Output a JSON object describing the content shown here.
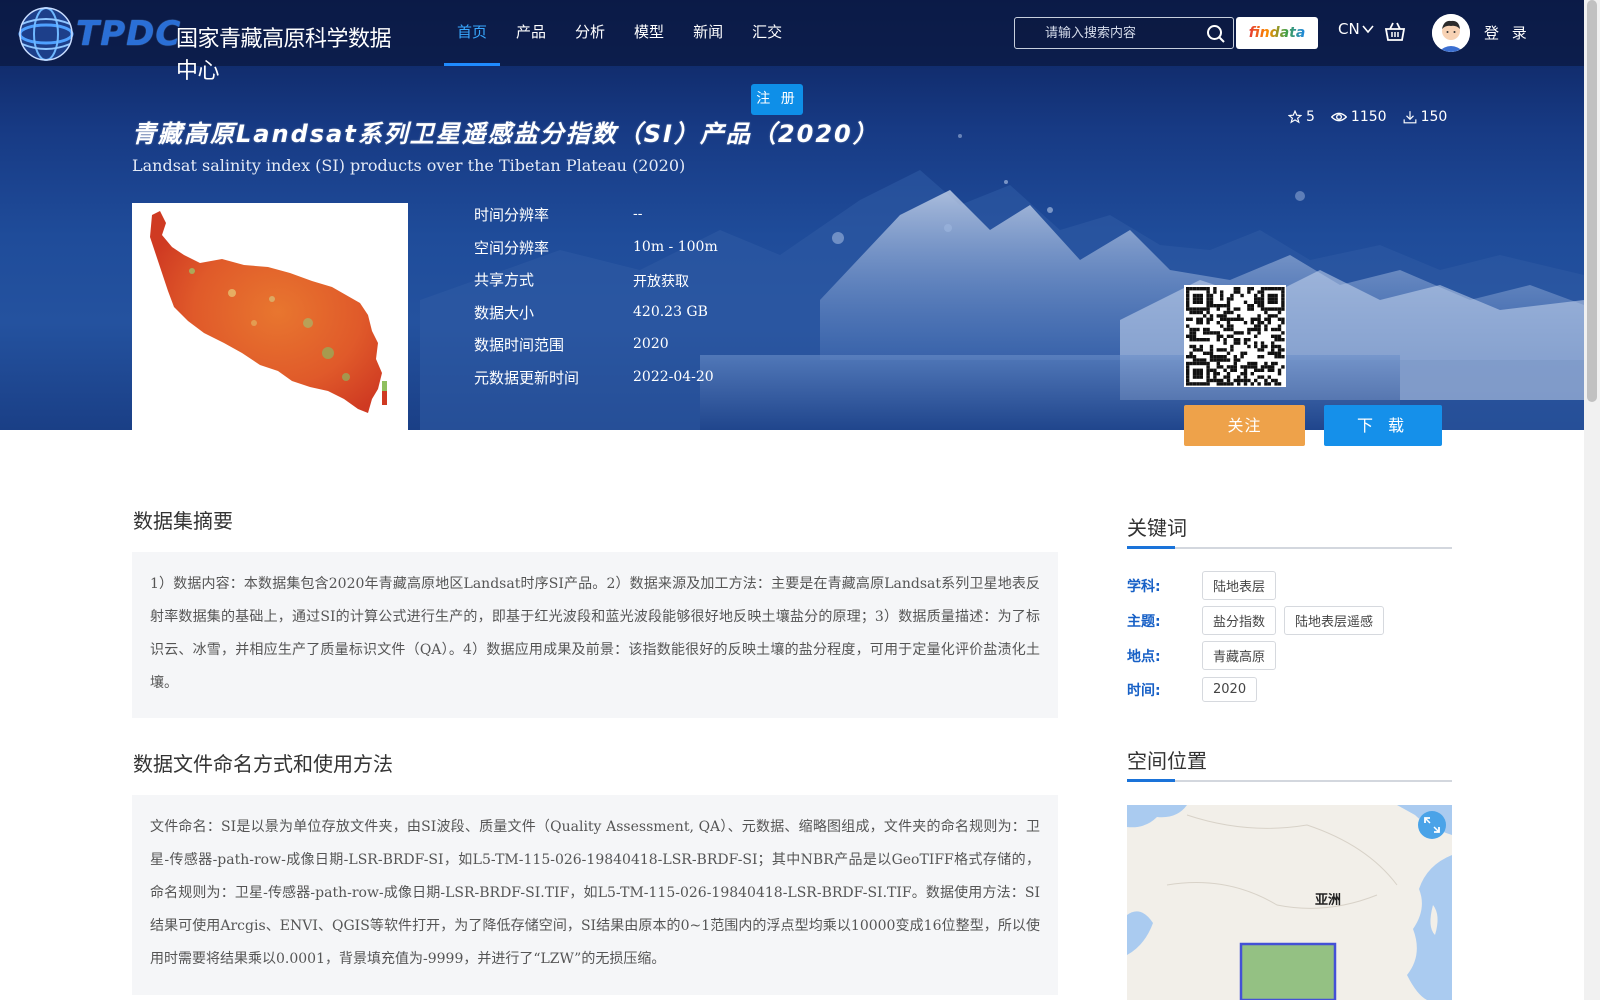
{
  "nav": {
    "logo_text": "TPDC",
    "site_name": "国家青藏高原科学数据中心",
    "items": [
      {
        "label": "首页",
        "active": true
      },
      {
        "label": "产品",
        "active": false
      },
      {
        "label": "分析",
        "active": false
      },
      {
        "label": "模型",
        "active": false
      },
      {
        "label": "新闻",
        "active": false
      },
      {
        "label": "汇交",
        "active": false
      }
    ],
    "search_placeholder": "请输入搜索内容",
    "findata_label": "findata",
    "language": "CN",
    "login_label": "登 录",
    "register_label": "注 册"
  },
  "dataset": {
    "title_cn": "青藏高原Landsat系列卫星遥感盐分指数（SI）产品（2020）",
    "title_en": "Landsat salinity index (SI) products over the Tibetan Plateau (2020)",
    "stats": {
      "stars": "5",
      "views": "1150",
      "downloads": "150"
    },
    "meta": [
      {
        "key": "时间分辨率",
        "value": "--"
      },
      {
        "key": "空间分辨率",
        "value": "10m - 100m"
      },
      {
        "key": "共享方式",
        "value": "开放获取"
      },
      {
        "key": "数据大小",
        "value": "420.23 GB"
      },
      {
        "key": "数据时间范围",
        "value": "2020"
      },
      {
        "key": "元数据更新时间",
        "value": "2022-04-20"
      }
    ],
    "follow_label": "关注",
    "download_label": "下 载"
  },
  "abstract": {
    "heading": "数据集摘要",
    "text": "1）数据内容：本数据集包含2020年青藏高原地区Landsat时序SI产品。2）数据来源及加工方法：主要是在青藏高原Landsat系列卫星地表反射率数据集的基础上，通过SI的计算公式进行生产的，即基于红光波段和蓝光波段能够很好地反映土壤盐分的原理；3）数据质量描述：为了标识云、冰雪，并相应生产了质量标识文件（QA）。4）数据应用成果及前景：该指数能很好的反映土壤的盐分程度，可用于定量化评价盐渍化土壤。"
  },
  "naming": {
    "heading": "数据文件命名方式和使用方法",
    "text": "文件命名：SI是以景为单位存放文件夹，由SI波段、质量文件（Quality Assessment, QA）、元数据、缩略图组成，文件夹的命名规则为：卫星-传感器-path-row-成像日期-LSR-BRDF-SI，如L5-TM-115-026-19840418-LSR-BRDF-SI；其中NBR产品是以GeoTIFF格式存储的，命名规则为：卫星-传感器-path-row-成像日期-LSR-BRDF-SI.TIF，如L5-TM-115-026-19840418-LSR-BRDF-SI.TIF。数据使用方法：SI结果可使用Arcgis、ENVI、QGIS等软件打开，为了降低存储空间，SI结果由原本的0~1范围内的浮点型均乘以10000变成16位整型，所以使用时需要将结果乘以0.0001，背景填充值为-9999，并进行了“LZW”的无损压缩。"
  },
  "keywords": {
    "heading": "关键词",
    "rows": [
      {
        "label": "学科:",
        "tags": [
          "陆地表层"
        ]
      },
      {
        "label": "主题:",
        "tags": [
          "盐分指数",
          "陆地表层遥感"
        ]
      },
      {
        "label": "地点:",
        "tags": [
          "青藏高原"
        ]
      },
      {
        "label": "时间:",
        "tags": [
          "2020"
        ]
      }
    ]
  },
  "location": {
    "heading": "空间位置",
    "map_label": "亚洲"
  },
  "colors": {
    "nav_active": "#38a8ff",
    "follow": "#eea24a",
    "download": "#1590ea",
    "keyword_label": "#1760c6"
  }
}
